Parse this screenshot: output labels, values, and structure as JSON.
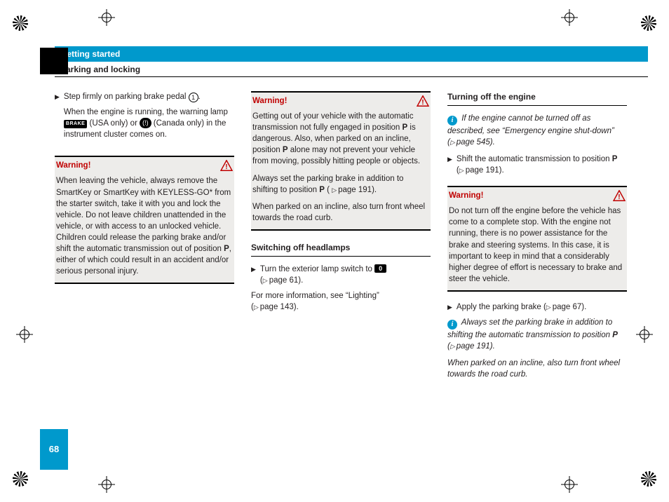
{
  "header": {
    "chapter": "Getting started",
    "section": "Parking and locking"
  },
  "warnings": {
    "label": "Warning!"
  },
  "col1": {
    "step1a": "Step firmly on parking brake pedal ",
    "callout1": "1",
    "step1b": ".",
    "step1c": "When the engine is running, the warning lamp ",
    "brake_badge": "BRAKE",
    "step1d": " (USA only) or ",
    "canada_badge": "(!)",
    "step1e": " (Canada only) in the instrument cluster comes on.",
    "warn": {
      "a": "When leaving the vehicle, always remove the SmartKey or SmartKey with KEYLESS-GO* from the starter switch, take it with you and lock the vehicle. Do not leave children unattended in the vehicle, or with access to an unlocked vehicle. Children could release the parking brake and/or shift the automatic transmission out of position ",
      "p": "P",
      "b": ", either of which could result in an accident and/or serious personal injury."
    }
  },
  "col2": {
    "warn": {
      "a": "Getting out of your vehicle with the automatic transmission not fully engaged in position ",
      "p1": "P",
      "b": " is dangerous. Also, when parked on an incline, position ",
      "p2": "P",
      "c": " alone may not prevent your vehicle from moving, possibly hitting people or objects.",
      "d": "Always set the parking brake in addition to shifting to position ",
      "p3": "P",
      "e": " (",
      "xref1": "page 191",
      "f": ").",
      "g": "When parked on an incline, also turn front wheel towards the road curb."
    },
    "subhead": "Switching off headlamps",
    "step": {
      "a": "Turn the exterior lamp switch to ",
      "zero": "0",
      "xref": "page 61"
    },
    "more": {
      "a": "For more information, see “Lighting”",
      "xref": "page 143"
    }
  },
  "col3": {
    "subhead": "Turning off the engine",
    "info1": {
      "a": "If the engine cannot be turned off as described, see “Emergency engine shut-down” ",
      "xref": "page 545"
    },
    "step1": {
      "a": "Shift the automatic transmission to position ",
      "p": "P",
      "xref": "page 191"
    },
    "warn": {
      "a": "Do not turn off the engine before the vehicle has come to a complete stop. With the engine not running, there is no power assistance for the brake and steering systems. In this case, it is important to keep in mind that a considerably higher degree of effort is necessary to brake and steer the vehicle."
    },
    "step2": {
      "a": "Apply the parking brake ",
      "xref": "page 67"
    },
    "info2": {
      "a": "Always set the parking brake in addition to shifting the automatic transmission to position ",
      "p": "P",
      "xref": "page 191",
      "b": "When parked on an incline, also turn front wheel towards the road curb."
    }
  },
  "footer": {
    "page": "68"
  }
}
